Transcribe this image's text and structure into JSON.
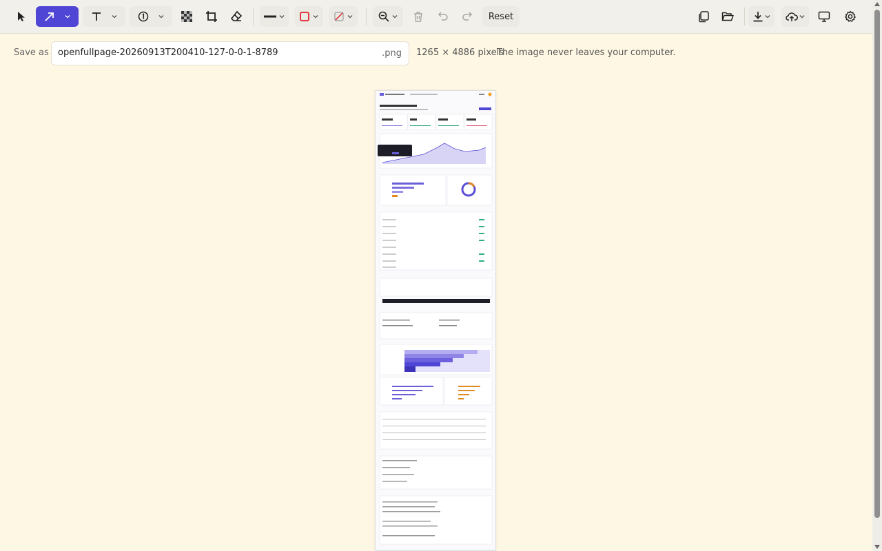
{
  "toolbar": {
    "tools": [
      {
        "name": "select-tool",
        "icon": "cursor-icon"
      },
      {
        "name": "arrow-tool",
        "icon": "arrow-icon"
      },
      {
        "name": "text-tool",
        "icon": "text-icon"
      },
      {
        "name": "number-marker-tool",
        "icon": "number-circle-icon"
      },
      {
        "name": "pixelate-tool",
        "icon": "checkerboard-icon"
      },
      {
        "name": "crop-tool",
        "icon": "crop-icon"
      },
      {
        "name": "eraser-tool",
        "icon": "eraser-icon"
      }
    ],
    "reset_label": "Reset",
    "active_color": "#5046d6",
    "stroke_color": "#e0393e",
    "fill_color": "#e0393e"
  },
  "save": {
    "label": "Save as",
    "filename": "openfullpage-20260913T200410-127-0-0-1-8789",
    "extension": ".png",
    "dimensions": "1265 × 4886 pixels",
    "privacy_note": "The image never leaves your computer."
  }
}
